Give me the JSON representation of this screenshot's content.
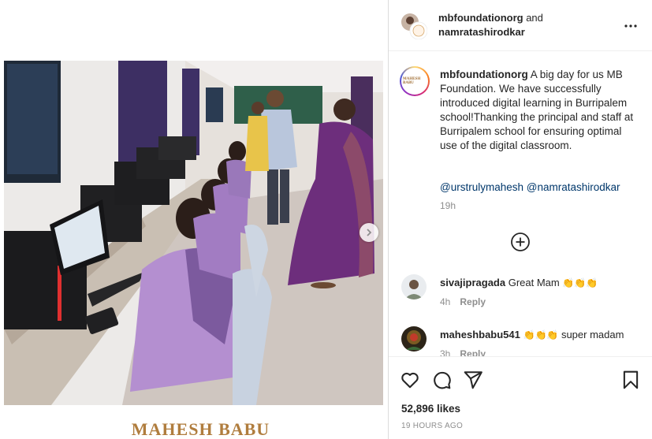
{
  "post": {
    "watermark": "MAHESH BABU"
  },
  "header": {
    "user1": "mbfoundationorg",
    "and": " and",
    "user2": "namratashirodkar"
  },
  "caption": {
    "username": "mbfoundationorg",
    "text": " A big day for us MB Foundation. We have successfully introduced digital learning in Burripalem school!Thanking the principal and staff at Burripalem school for ensuring optimal use of the digital classroom.",
    "mention1": "@urstrulymahesh",
    "mention2": "@namratashirodkar",
    "time": "19h",
    "avatar_text": "MAHESH BABU"
  },
  "comments": [
    {
      "username": "sivajipragada",
      "text": " Great Mam ",
      "emoji": "👏👏👏",
      "time": "4h",
      "reply": "Reply"
    },
    {
      "username": "maheshbabu541",
      "emoji": "👏👏👏",
      "text": " super madam",
      "time": "3h",
      "reply": "Reply"
    }
  ],
  "actions": {
    "likes": "52,896 likes",
    "time": "19 HOURS AGO"
  },
  "icons": {
    "more": "more-options-icon",
    "add": "add-circle-icon",
    "like": "heart-icon",
    "comment": "comment-icon",
    "share": "share-icon",
    "save": "bookmark-icon",
    "next": "chevron-right-icon"
  },
  "colors": {
    "link": "#00376b",
    "secondary": "#8e8e8e",
    "text": "#262626"
  }
}
